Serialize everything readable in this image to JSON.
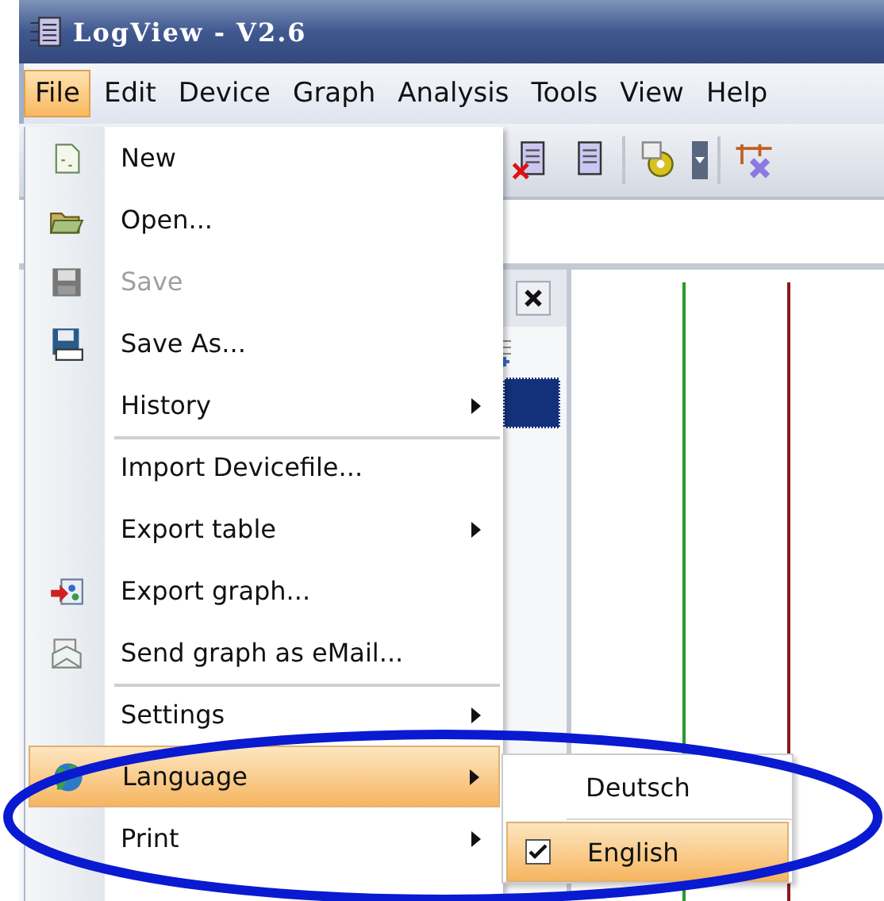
{
  "window": {
    "title": "LogView - V2.6"
  },
  "menu_bar": [
    {
      "label": "File",
      "selected": true
    },
    {
      "label": "Edit",
      "selected": false
    },
    {
      "label": "Device",
      "selected": false
    },
    {
      "label": "Graph",
      "selected": false
    },
    {
      "label": "Analysis",
      "selected": false
    },
    {
      "label": "Tools",
      "selected": false
    },
    {
      "label": "View",
      "selected": false
    },
    {
      "label": "Help",
      "selected": false
    }
  ],
  "file_menu": [
    {
      "label": "New",
      "disabled": false,
      "submenu": false,
      "selected": false,
      "separator": false
    },
    {
      "label": "Open...",
      "disabled": false,
      "submenu": false,
      "selected": false,
      "separator": false
    },
    {
      "label": "Save",
      "disabled": true,
      "submenu": false,
      "selected": false,
      "separator": false
    },
    {
      "label": "Save As...",
      "disabled": false,
      "submenu": false,
      "selected": false,
      "separator": false
    },
    {
      "label": "History",
      "disabled": false,
      "submenu": true,
      "selected": false,
      "separator": false
    },
    {
      "label": "Import Devicefile...",
      "disabled": false,
      "submenu": false,
      "selected": false,
      "separator": true
    },
    {
      "label": "Export table",
      "disabled": false,
      "submenu": true,
      "selected": false,
      "separator": false
    },
    {
      "label": "Export graph...",
      "disabled": false,
      "submenu": false,
      "selected": false,
      "separator": false
    },
    {
      "label": "Send graph as eMail...",
      "disabled": false,
      "submenu": false,
      "selected": false,
      "separator": false
    },
    {
      "label": "Settings",
      "disabled": false,
      "submenu": true,
      "selected": false,
      "separator": true
    },
    {
      "label": "Language",
      "disabled": false,
      "submenu": true,
      "selected": true,
      "separator": false
    },
    {
      "label": "Print",
      "disabled": false,
      "submenu": true,
      "selected": false,
      "separator": false
    }
  ],
  "language_submenu": [
    {
      "label": "Deutsch",
      "checked": false,
      "selected": false
    },
    {
      "label": "English",
      "checked": true,
      "selected": true
    }
  ]
}
